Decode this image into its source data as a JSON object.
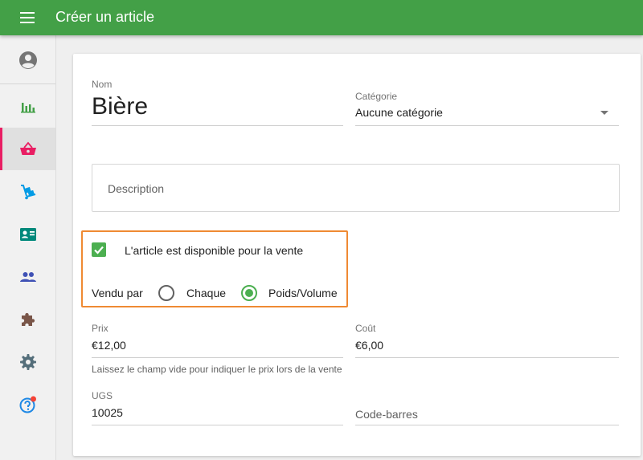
{
  "header": {
    "title": "Créer un article"
  },
  "sidebar": {
    "items": [
      {
        "name": "account",
        "icon": "account-circle-icon",
        "color": "#757575"
      },
      {
        "name": "reports",
        "icon": "bar-chart-icon",
        "color": "#43a047"
      },
      {
        "name": "items",
        "icon": "basket-icon",
        "color": "#e91e63",
        "active": true
      },
      {
        "name": "inventory",
        "icon": "hand-truck-icon",
        "color": "#039be5"
      },
      {
        "name": "employees",
        "icon": "badge-icon",
        "color": "#00897b"
      },
      {
        "name": "customers",
        "icon": "people-icon",
        "color": "#3f51b5"
      },
      {
        "name": "integrations",
        "icon": "puzzle-icon",
        "color": "#795548"
      },
      {
        "name": "settings",
        "icon": "gear-icon",
        "color": "#546e7a"
      },
      {
        "name": "help",
        "icon": "help-icon",
        "color": "#1e88e5",
        "badge_color": "#f44336"
      }
    ]
  },
  "form": {
    "name_label": "Nom",
    "name_value": "Bière",
    "category_label": "Catégorie",
    "category_value": "Aucune catégorie",
    "description_placeholder": "Description",
    "available_label": "L'article est disponible pour la vente",
    "available_checked": true,
    "sold_by_label": "Vendu par",
    "sold_by_options": [
      {
        "label": "Chaque",
        "checked": false
      },
      {
        "label": "Poids/Volume",
        "checked": true
      }
    ],
    "price_label": "Prix",
    "price_value": "€12,00",
    "price_hint": "Laissez le champ vide pour indiquer le prix lors de la vente",
    "cost_label": "Coût",
    "cost_value": "€6,00",
    "sku_label": "UGS",
    "sku_value": "10025",
    "barcode_placeholder": "Code-barres"
  },
  "colors": {
    "primary": "#43a047",
    "accent": "#4caf50",
    "highlight": "#ef8a33"
  }
}
